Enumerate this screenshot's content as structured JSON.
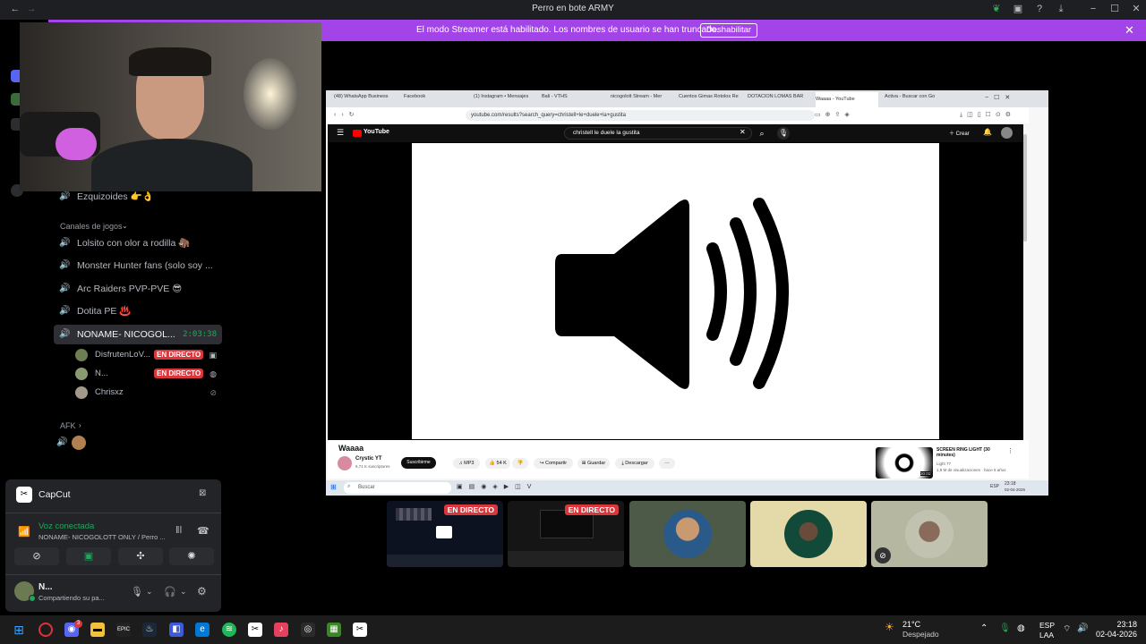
{
  "window": {
    "title": "Perro en bote ARMY"
  },
  "banner": {
    "text": "El modo Streamer está habilitado. Los nombres de usuario se han truncado.",
    "button": "Deshabilitar"
  },
  "channels": {
    "top_channel": "Ezquizoides 👉👌",
    "category": "Canales de jogos",
    "items": [
      {
        "label": "Lolsito con olor a rodilla 🦣"
      },
      {
        "label": "Monster Hunter fans (solo soy ..."
      },
      {
        "label": "Arc Raiders PVP-PVE 😎"
      },
      {
        "label": "Dotita PE ♨️"
      }
    ],
    "active": {
      "label": "NONAME- NICOGOL...",
      "time": "2:03:38"
    },
    "users": [
      {
        "name": "DisfrutenLoV...",
        "live": "EN DIRECTO"
      },
      {
        "name": "N...",
        "live": "EN DIRECTO"
      },
      {
        "name": "Chrisxz",
        "live": ""
      }
    ],
    "afk": "AFK"
  },
  "panel": {
    "activity": "CapCut",
    "voice_status": "Voz conectada",
    "voice_channel": "NONAME- NICOGOLOTT ONLY / Perro ...",
    "user_name": "N...",
    "user_status": "Compartiendo su pa..."
  },
  "browser": {
    "tabs": [
      "(48) WhatsApp Business",
      "Facebook",
      "(1) Instagram • Mensajes",
      "Bali - VTHS",
      "nicogolott Stream - Mer",
      "Cuentos Gimas Rotolos Re",
      "DOTACIÓN LOMAS BAR",
      "Waaaa - YouTube",
      "Activa - Buscar con Go"
    ],
    "url": "youtube.com/results?search_query=christell+le+duele+la+gustita",
    "search": "christell le duele la gustita",
    "create": "Crear",
    "video_title": "Waaaa",
    "channel": "Crystic YT",
    "subs": "6,71 K suscriptores",
    "subscribe": "Suscribirme",
    "actions": [
      "MP3",
      "54 K",
      "",
      "Compartir",
      "Guardar",
      "Descargar"
    ],
    "suggest_title": "SCREEN RING LIGHT (30 minutes)",
    "suggest_meta": "1,9 M de visualizaciones · hace 5 años",
    "suggest_channel": "Light 77",
    "suggest_duration": "30:01",
    "inner_search": "Buscar",
    "inner_time": "23:18",
    "inner_date": "02-04-2026",
    "inner_lang": "ESP"
  },
  "tiles": [
    {
      "live": "EN DIRECTO",
      "bg": "#0d1220"
    },
    {
      "live": "EN DIRECTO",
      "bg": "#151515"
    },
    {
      "live": "",
      "bg": "#4c5a47"
    },
    {
      "live": "",
      "bg": "#e4d9a8"
    },
    {
      "live": "",
      "bg": "#b5b7a0"
    }
  ],
  "taskbar": {
    "weather_temp": "21°C",
    "weather_desc": "Despejado",
    "lang": "ESP",
    "lang2": "LAA",
    "time": "23:18",
    "date": "02-04-2026",
    "discord_badge": "3"
  },
  "colors": {
    "banner": "#a344e8",
    "live": "#da373c",
    "accent_green": "#23a55a"
  }
}
